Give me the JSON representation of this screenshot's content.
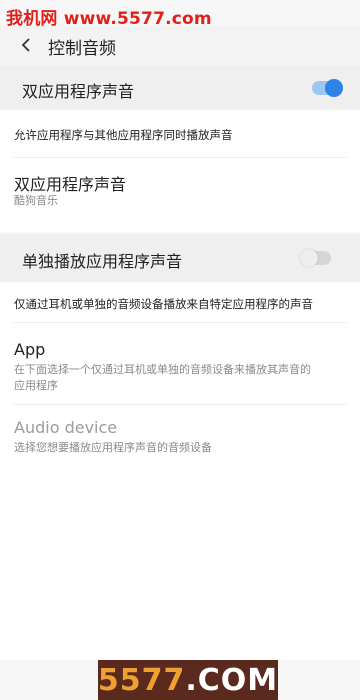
{
  "watermark_top": "我机网 www.5577.com",
  "header": {
    "title": "控制音频"
  },
  "dual_app_audio": {
    "label": "双应用程序声音",
    "enabled": true
  },
  "dual_app_desc": "允许应用程序与其他应用程序同时播放声音",
  "dual_app_item": {
    "title": "双应用程序声音",
    "subtitle": "酷狗音乐"
  },
  "single_app_audio": {
    "label": "单独播放应用程序声音",
    "enabled": false
  },
  "single_app_desc": "仅通过耳机或单独的音频设备播放来自特定应用程序的声音",
  "app_item": {
    "title": "App",
    "subtitle_line1": "在下面选择一个仅通过耳机或单独的音频设备来播放其声音的",
    "subtitle_line2": "应用程序"
  },
  "audio_device_item": {
    "title": "Audio device",
    "subtitle": "选择您想要播放应用程序声音的音频设备"
  },
  "watermark_bottom": {
    "main": "5577",
    "sep": ".",
    "suffix": "COM"
  },
  "colors": {
    "accent": "#2d84e6",
    "watermark": "#e0201a"
  }
}
